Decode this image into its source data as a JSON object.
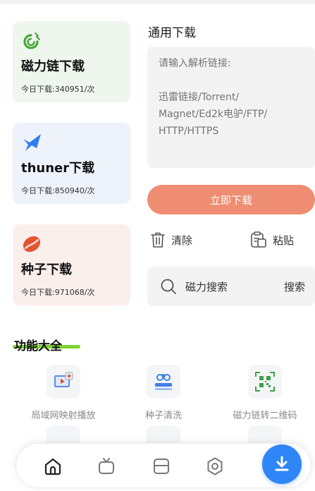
{
  "cards": [
    {
      "title": "磁力链下载",
      "count": "今日下载:340951/次",
      "icon": "magnet-icon"
    },
    {
      "title": "thuner下载",
      "count": "今日下载:850940/次",
      "icon": "bird-icon"
    },
    {
      "title": "种子下载",
      "count": "今日下载:971068/次",
      "icon": "seed-icon"
    }
  ],
  "general": {
    "title": "通用下载",
    "placeholder": "请输入解析链接:\n\n迅雷链接/Torrent/\nMagnet/Ed2k电驴/FTP/\nHTTP/HTTPS",
    "download_label": "立即下载",
    "clear_label": "清除",
    "paste_label": "粘贴"
  },
  "search": {
    "placeholder": "磁力搜索",
    "button": "搜索"
  },
  "functions": {
    "title": "功能大全",
    "items": [
      {
        "label": "局域网映射播放",
        "icon": "cast-play-icon"
      },
      {
        "label": "种子清洗",
        "icon": "seed-clean-icon"
      },
      {
        "label": "磁力链转二维码",
        "icon": "qrcode-icon"
      }
    ]
  },
  "nav": {
    "items": [
      "home-icon",
      "tv-icon",
      "files-icon",
      "settings-icon"
    ],
    "fab": "download-icon"
  },
  "colors": {
    "accent_orange": "#ee8d72",
    "accent_blue": "#2f86f6",
    "accent_green": "#7fd332"
  }
}
